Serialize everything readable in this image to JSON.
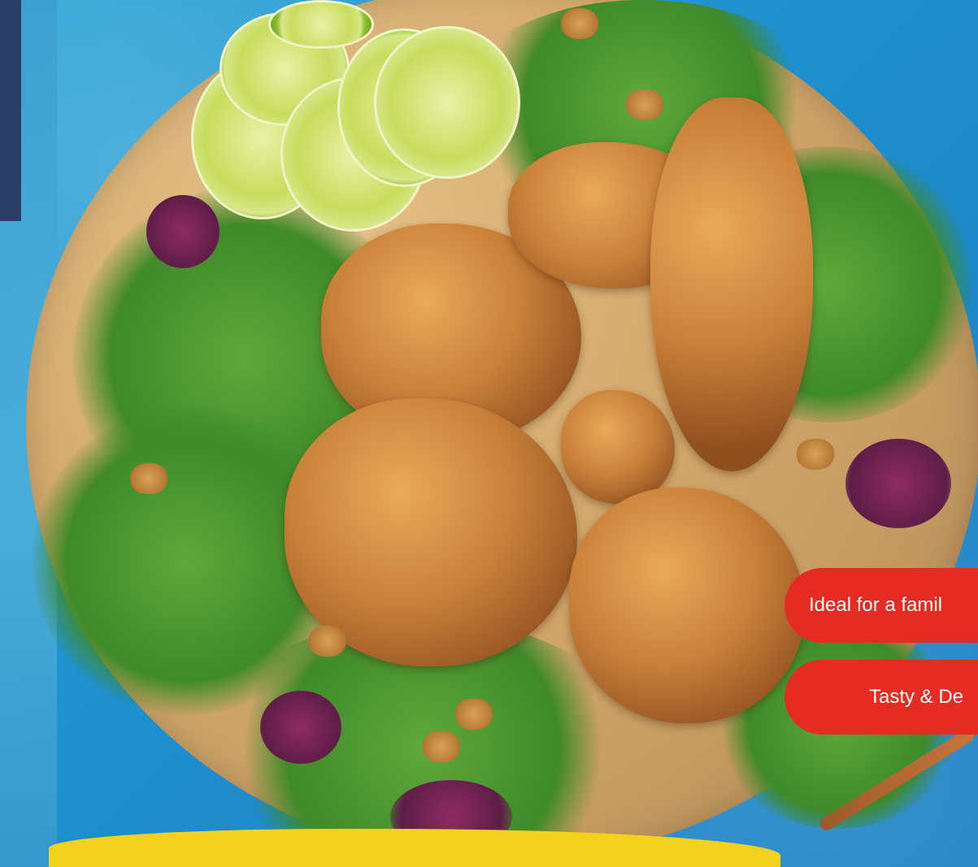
{
  "badges": {
    "family": "Ideal for a famil",
    "tasty": "Tasty & De"
  },
  "colors": {
    "badge_background": "#e42c25",
    "badge_text": "#ffffff",
    "background_blue": "#1f8fcd",
    "accent_yellow": "#f2d21c"
  }
}
